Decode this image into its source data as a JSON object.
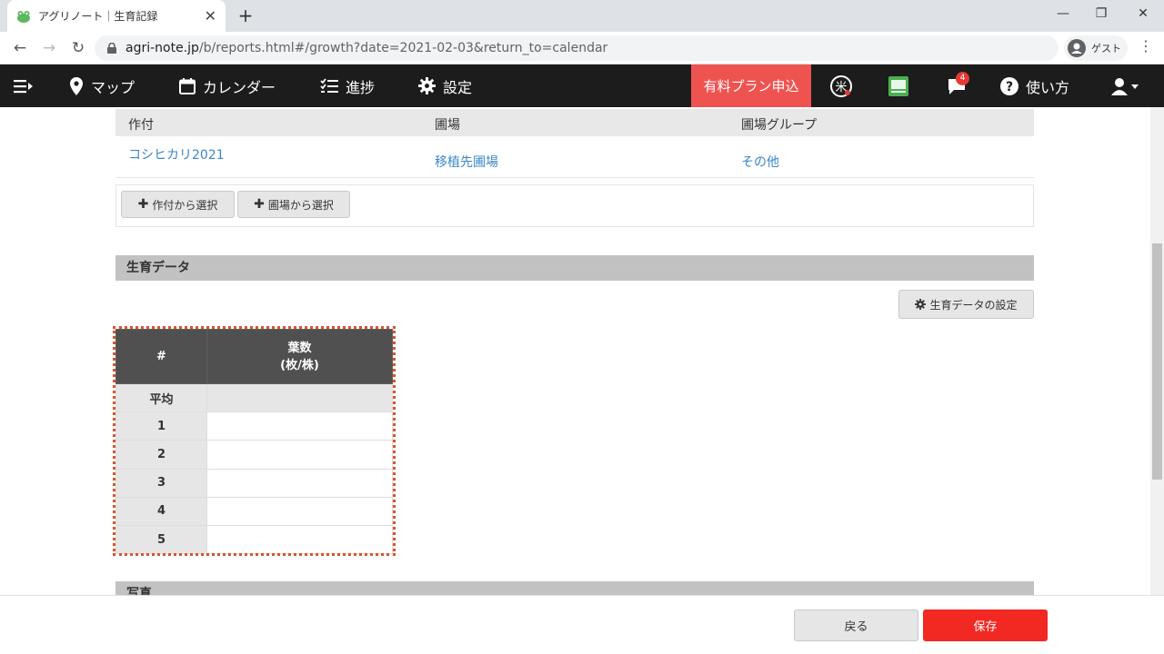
{
  "browser": {
    "tab_title": "アグリノート｜生育記録",
    "url_domain": "agri-note.jp",
    "url_path": "/b/reports.html#/growth?date=2021-02-03&return_to=calendar",
    "profile_label": "ゲスト"
  },
  "navbar": {
    "map": "マップ",
    "calendar": "カレンダー",
    "progress": "進捗",
    "settings": "設定",
    "paid_plan": "有料プラン申込",
    "notification_count": "4",
    "help": "使い方",
    "accent_color": "#ef5350"
  },
  "crop_table": {
    "headers": [
      "作付",
      "圃場",
      "圃場グループ"
    ],
    "row": {
      "crop": "コシヒカリ2021",
      "field": "移植先圃場",
      "group": "その他"
    }
  },
  "select_buttons": {
    "from_crop": "作付から選択",
    "from_field": "圃場から選択"
  },
  "growth_section": {
    "title": "生育データ",
    "settings_button": "生育データの設定",
    "table": {
      "col_index": "#",
      "col_leaves_line1": "葉数",
      "col_leaves_line2": "(枚/株)",
      "rows": [
        "平均",
        "1",
        "2",
        "3",
        "4",
        "5"
      ]
    }
  },
  "photo_section": {
    "title": "写真"
  },
  "footer": {
    "back": "戻る",
    "save": "保存",
    "save_color": "#f22822"
  }
}
